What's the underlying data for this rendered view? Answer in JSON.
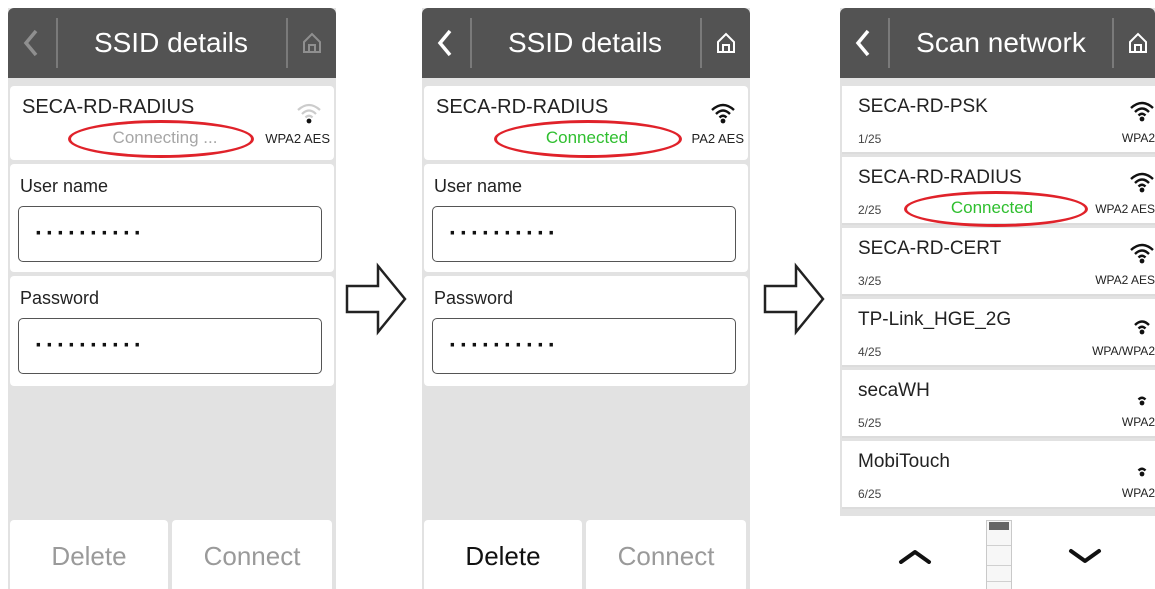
{
  "screen1": {
    "title": "SSID details",
    "network_name": "SECA-RD-RADIUS",
    "status": "Connecting ...",
    "security": "WPA2 AES",
    "user_label": "User name",
    "user_value": "··········",
    "password_label": "Password",
    "password_value": "··········",
    "delete_label": "Delete",
    "connect_label": "Connect"
  },
  "screen2": {
    "title": "SSID details",
    "network_name": "SECA-RD-RADIUS",
    "status": "Connected",
    "security": "PA2 AES",
    "user_label": "User name",
    "user_value": "··········",
    "password_label": "Password",
    "password_value": "··········",
    "delete_label": "Delete",
    "connect_label": "Connect"
  },
  "screen3": {
    "title": "Scan network",
    "networks": [
      {
        "name": "SECA-RD-PSK",
        "index": "1/25",
        "security": "WPA2",
        "signal": 3
      },
      {
        "name": "SECA-RD-RADIUS",
        "index": "2/25",
        "security": "WPA2 AES",
        "signal": 3,
        "status": "Connected"
      },
      {
        "name": "SECA-RD-CERT",
        "index": "3/25",
        "security": "WPA2 AES",
        "signal": 3
      },
      {
        "name": "TP-Link_HGE_2G",
        "index": "4/25",
        "security": "WPA/WPA2",
        "signal": 2
      },
      {
        "name": "secaWH",
        "index": "5/25",
        "security": "WPA2",
        "signal": 1
      },
      {
        "name": "MobiTouch",
        "index": "6/25",
        "security": "WPA2",
        "signal": 1
      }
    ]
  },
  "icons": {
    "back": "chevron-left-icon",
    "home": "home-icon",
    "wifi": "wifi-signal-icon",
    "next": "right-arrow-icon",
    "scroll_up": "chevron-up-icon",
    "scroll_down": "chevron-down-icon"
  },
  "colors": {
    "titlebar": "#535353",
    "background": "#e2e2e2",
    "connected": "#2fbf2f",
    "highlight": "#e0222a",
    "disabled_text": "#9a9a9a"
  }
}
